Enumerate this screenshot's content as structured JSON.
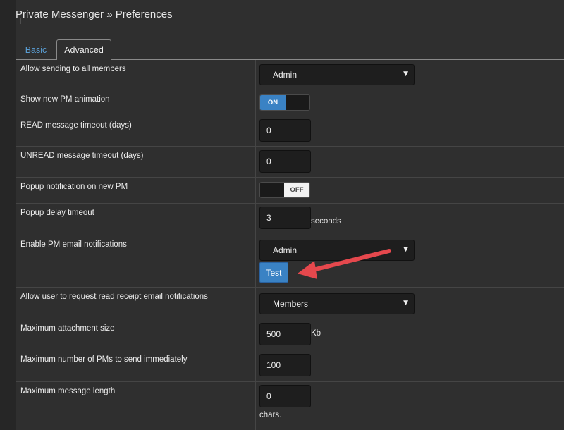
{
  "page": {
    "title": "Private Messenger » Preferences"
  },
  "tabs": [
    {
      "label": "Basic",
      "active": false
    },
    {
      "label": "Advanced",
      "active": true
    }
  ],
  "colors": {
    "accent": "#3a82c4",
    "annotation_arrow": "#e5484d",
    "link": "#5a9fd6"
  },
  "rows": [
    {
      "label": "Allow sending to all members",
      "control": "select",
      "value": "Admin"
    },
    {
      "label": "Show new PM animation",
      "control": "toggle",
      "value": "ON"
    },
    {
      "label": "READ message timeout (days)",
      "control": "number",
      "value": "0"
    },
    {
      "label": "UNREAD message timeout (days)",
      "control": "number",
      "value": "0"
    },
    {
      "label": "Popup notification on new PM",
      "control": "toggle",
      "value": "OFF"
    },
    {
      "label": "Popup delay timeout",
      "control": "number",
      "value": "3",
      "unit": "seconds"
    },
    {
      "label": "Enable PM email notifications",
      "control": "select",
      "value": "Admin",
      "button": "Test"
    },
    {
      "label": "Allow user to request read receipt email notifications",
      "control": "select",
      "value": "Members"
    },
    {
      "label": "Maximum attachment size",
      "control": "number",
      "value": "500",
      "unit": "Kb"
    },
    {
      "label": "Maximum number of PMs to send immediately",
      "control": "number",
      "value": "100"
    },
    {
      "label": "Maximum message length",
      "control": "number",
      "value": "0",
      "unit": "chars."
    }
  ],
  "icons": {
    "select_arrow": "dropdown-triangle-icon",
    "annotation": "red-arrow-annotation"
  }
}
